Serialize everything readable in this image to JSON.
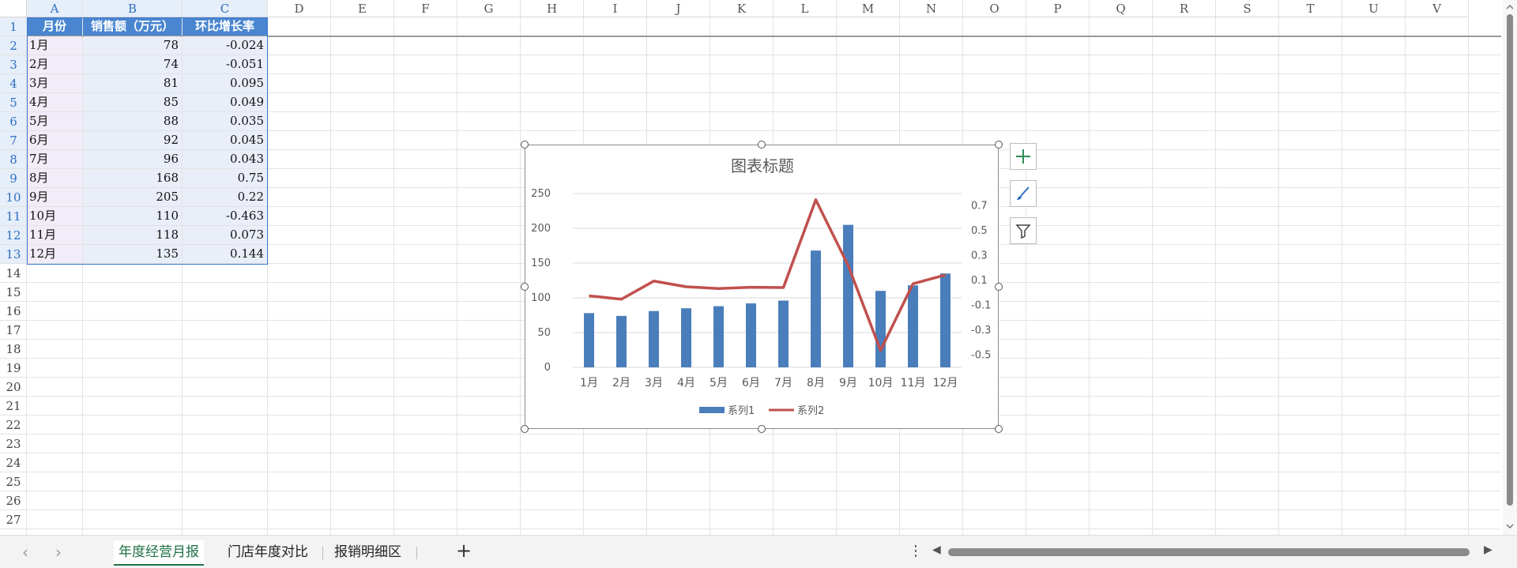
{
  "columns": [
    "A",
    "B",
    "C",
    "D",
    "E",
    "F",
    "G",
    "H",
    "I",
    "J",
    "K",
    "L",
    "M",
    "N",
    "O",
    "P",
    "Q",
    "R",
    "S",
    "T",
    "U",
    "V"
  ],
  "rows": [
    "1",
    "2",
    "3",
    "4",
    "5",
    "6",
    "7",
    "8",
    "9",
    "10",
    "11",
    "12",
    "13",
    "14",
    "15",
    "16",
    "17",
    "18",
    "19",
    "20",
    "21",
    "22",
    "23",
    "24",
    "25",
    "26",
    "27"
  ],
  "table": {
    "headers": [
      "月份",
      "销售额（万元）",
      "环比增长率"
    ],
    "rows": [
      [
        "1月",
        "78",
        "-0.024"
      ],
      [
        "2月",
        "74",
        "-0.051"
      ],
      [
        "3月",
        "81",
        "0.095"
      ],
      [
        "4月",
        "85",
        "0.049"
      ],
      [
        "5月",
        "88",
        "0.035"
      ],
      [
        "6月",
        "92",
        "0.045"
      ],
      [
        "7月",
        "96",
        "0.043"
      ],
      [
        "8月",
        "168",
        "0.75"
      ],
      [
        "9月",
        "205",
        "0.22"
      ],
      [
        "10月",
        "110",
        "-0.463"
      ],
      [
        "11月",
        "118",
        "0.073"
      ],
      [
        "12月",
        "135",
        "0.144"
      ]
    ]
  },
  "chart_data": {
    "type": "bar",
    "title": "图表标题",
    "categories": [
      "1月",
      "2月",
      "3月",
      "4月",
      "5月",
      "6月",
      "7月",
      "8月",
      "9月",
      "10月",
      "11月",
      "12月"
    ],
    "series": [
      {
        "name": "系列1",
        "type": "bar",
        "axis": "left",
        "color": "#4a7ebb",
        "values": [
          78,
          74,
          81,
          85,
          88,
          92,
          96,
          168,
          205,
          110,
          118,
          135
        ]
      },
      {
        "name": "系列2",
        "type": "line",
        "axis": "right",
        "color": "#c0504d",
        "values": [
          -0.024,
          -0.051,
          0.095,
          0.049,
          0.035,
          0.045,
          0.043,
          0.75,
          0.22,
          -0.463,
          0.073,
          0.144
        ]
      }
    ],
    "y_left": {
      "ylim": [
        0,
        250
      ],
      "ticks": [
        "0",
        "50",
        "100",
        "150",
        "200",
        "250"
      ]
    },
    "y_right": {
      "ylim": [
        -0.6,
        0.8
      ],
      "ticks": [
        "-0.5",
        "-0.3",
        "-0.1",
        "0.1",
        "0.3",
        "0.5",
        "0.7"
      ]
    },
    "legend": "bottom",
    "grid": true
  },
  "side_buttons": [
    {
      "icon": "plus-icon"
    },
    {
      "icon": "brush-icon"
    },
    {
      "icon": "filter-icon"
    }
  ],
  "sheet_tabs": {
    "tabs": [
      "年度经营月报",
      "门店年度对比",
      "报销明细区"
    ],
    "active": "年度经营月报",
    "add": "+",
    "more": "⋮"
  },
  "colors": {
    "accent": "#4a86d0",
    "active_tab": "#1e7145",
    "bar": "#4a7ebb",
    "line": "#c0504d"
  }
}
